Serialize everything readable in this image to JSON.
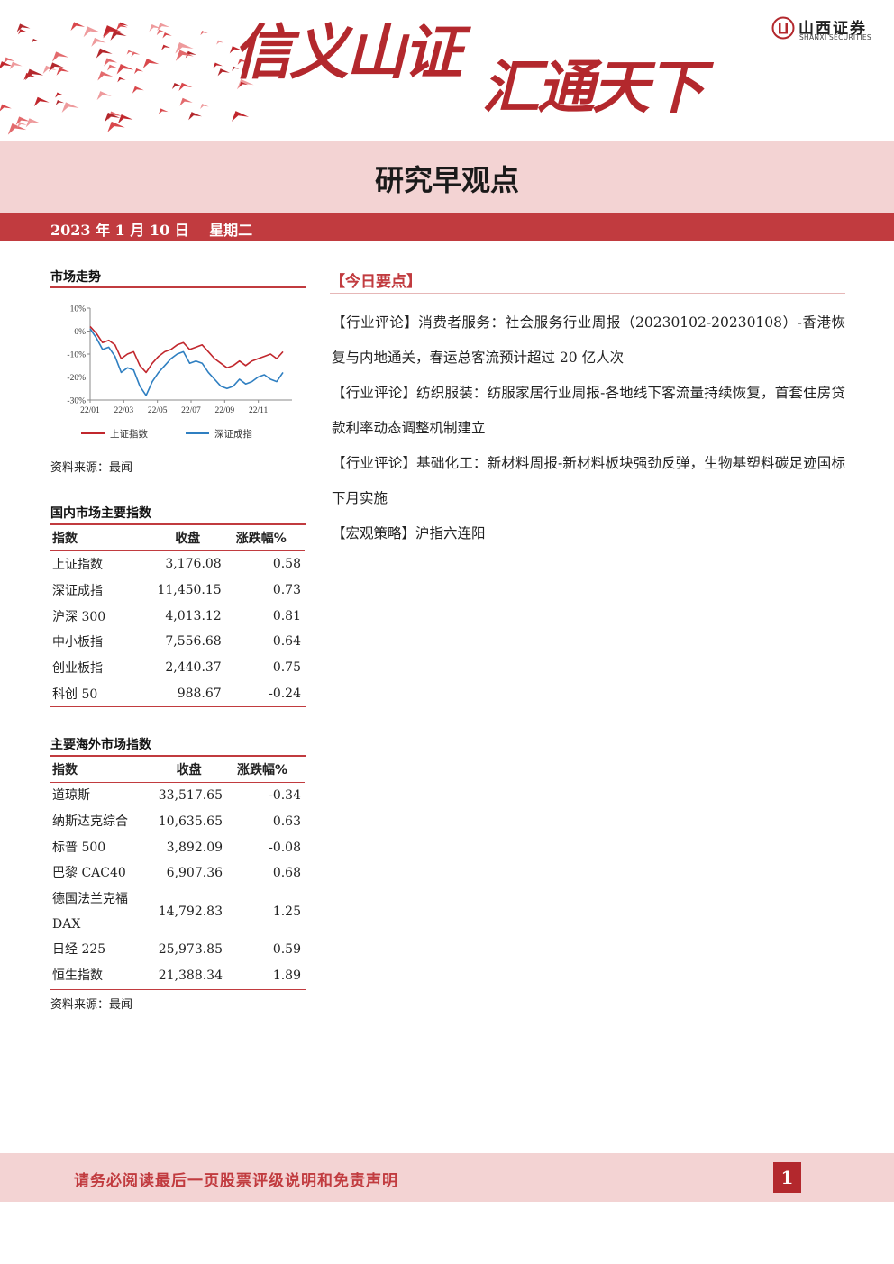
{
  "header": {
    "slogan_left": "信义山证",
    "slogan_right": "汇通天下",
    "logo_cn": "山西证券",
    "logo_en": "SHANXI SECURITIES"
  },
  "title": "研究早观点",
  "date": "2023 年 1 月 10 日    星期二",
  "market_trend": {
    "heading": "市场走势",
    "source": "资料来源：最闻",
    "chart_data": {
      "type": "line",
      "x_ticks": [
        "22/01",
        "22/03",
        "22/05",
        "22/07",
        "22/09",
        "22/11"
      ],
      "y_ticks": [
        "10%",
        "0%",
        "-10%",
        "-20%",
        "-30%"
      ],
      "ylim": [
        -30,
        10
      ],
      "series": [
        {
          "name": "上证指数",
          "color": "#c1272d",
          "values": [
            2,
            -1,
            -5,
            -4,
            -6,
            -12,
            -10,
            -9,
            -15,
            -18,
            -14,
            -11,
            -9,
            -8,
            -6,
            -5,
            -8,
            -7,
            -6,
            -9,
            -12,
            -14,
            -16,
            -15,
            -13,
            -15,
            -13,
            -12,
            -11,
            -10,
            -12,
            -9
          ]
        },
        {
          "name": "深证成指",
          "color": "#2f7fc1",
          "values": [
            1,
            -3,
            -8,
            -7,
            -11,
            -18,
            -16,
            -17,
            -24,
            -28,
            -22,
            -18,
            -15,
            -12,
            -10,
            -9,
            -14,
            -13,
            -14,
            -18,
            -21,
            -24,
            -25,
            -24,
            -21,
            -23,
            -22,
            -20,
            -19,
            -21,
            -22,
            -18
          ]
        }
      ]
    }
  },
  "domestic": {
    "heading": "国内市场主要指数",
    "columns": [
      "指数",
      "收盘",
      "涨跌幅%"
    ],
    "rows": [
      [
        "上证指数",
        "3,176.08",
        "0.58"
      ],
      [
        "深证成指",
        "11,450.15",
        "0.73"
      ],
      [
        "沪深 300",
        "4,013.12",
        "0.81"
      ],
      [
        "中小板指",
        "7,556.68",
        "0.64"
      ],
      [
        "创业板指",
        "2,440.37",
        "0.75"
      ],
      [
        "科创 50",
        "988.67",
        "-0.24"
      ]
    ]
  },
  "overseas": {
    "heading": "主要海外市场指数",
    "columns": [
      "指数",
      "收盘",
      "涨跌幅%"
    ],
    "rows": [
      [
        "道琼斯",
        "33,517.65",
        "-0.34"
      ],
      [
        "纳斯达克综合",
        "10,635.65",
        "0.63"
      ],
      [
        "标普 500",
        "3,892.09",
        "-0.08"
      ],
      [
        "巴黎 CAC40",
        "6,907.36",
        "0.68"
      ],
      [
        "德国法兰克福 DAX",
        "14,792.83",
        "1.25"
      ],
      [
        "日经 225",
        "25,973.85",
        "0.59"
      ],
      [
        "恒生指数",
        "21,388.34",
        "1.89"
      ]
    ],
    "source": "资料来源：最闻"
  },
  "today": {
    "heading": "【今日要点】",
    "items": [
      "【行业评论】消费者服务：社会服务行业周报（20230102-20230108）-香港恢复与内地通关，春运总客流预计超过 20 亿人次",
      "【行业评论】纺织服装：纺服家居行业周报-各地线下客流量持续恢复，首套住房贷款利率动态调整机制建立",
      "【行业评论】基础化工：新材料周报-新材料板块强劲反弹，生物基塑料碳足迹国标下月实施",
      "【宏观策略】沪指六连阳"
    ]
  },
  "footer": {
    "notice": "请务必阅读最后一页股票评级说明和免责声明",
    "page": "1"
  }
}
